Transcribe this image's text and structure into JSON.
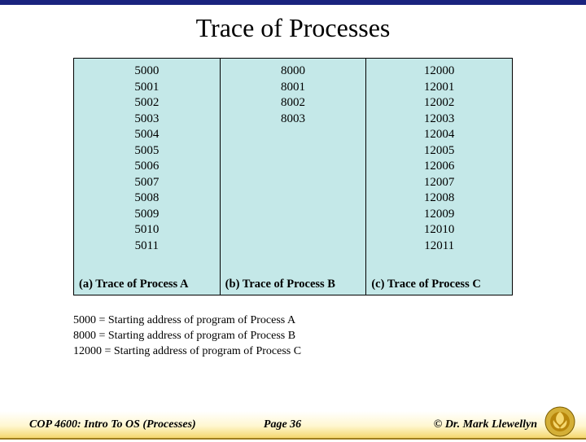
{
  "title": "Trace of Processes",
  "columns": [
    {
      "label": "(a) Trace of Process A",
      "values": [
        "5000",
        "5001",
        "5002",
        "5003",
        "5004",
        "5005",
        "5006",
        "5007",
        "5008",
        "5009",
        "5010",
        "5011"
      ]
    },
    {
      "label": "(b) Trace of Process B",
      "values": [
        "8000",
        "8001",
        "8002",
        "8003"
      ]
    },
    {
      "label": "(c) Trace of Process C",
      "values": [
        "12000",
        "12001",
        "12002",
        "12003",
        "12004",
        "12005",
        "12006",
        "12007",
        "12008",
        "12009",
        "12010",
        "12011"
      ]
    }
  ],
  "legend": [
    "5000 = Starting address of program of Process A",
    "8000 = Starting address of program of Process B",
    "12000 = Starting address of program of Process C"
  ],
  "footer": {
    "left": "COP 4600: Intro To OS  (Processes)",
    "center": "Page 36",
    "right": "© Dr. Mark Llewellyn"
  }
}
